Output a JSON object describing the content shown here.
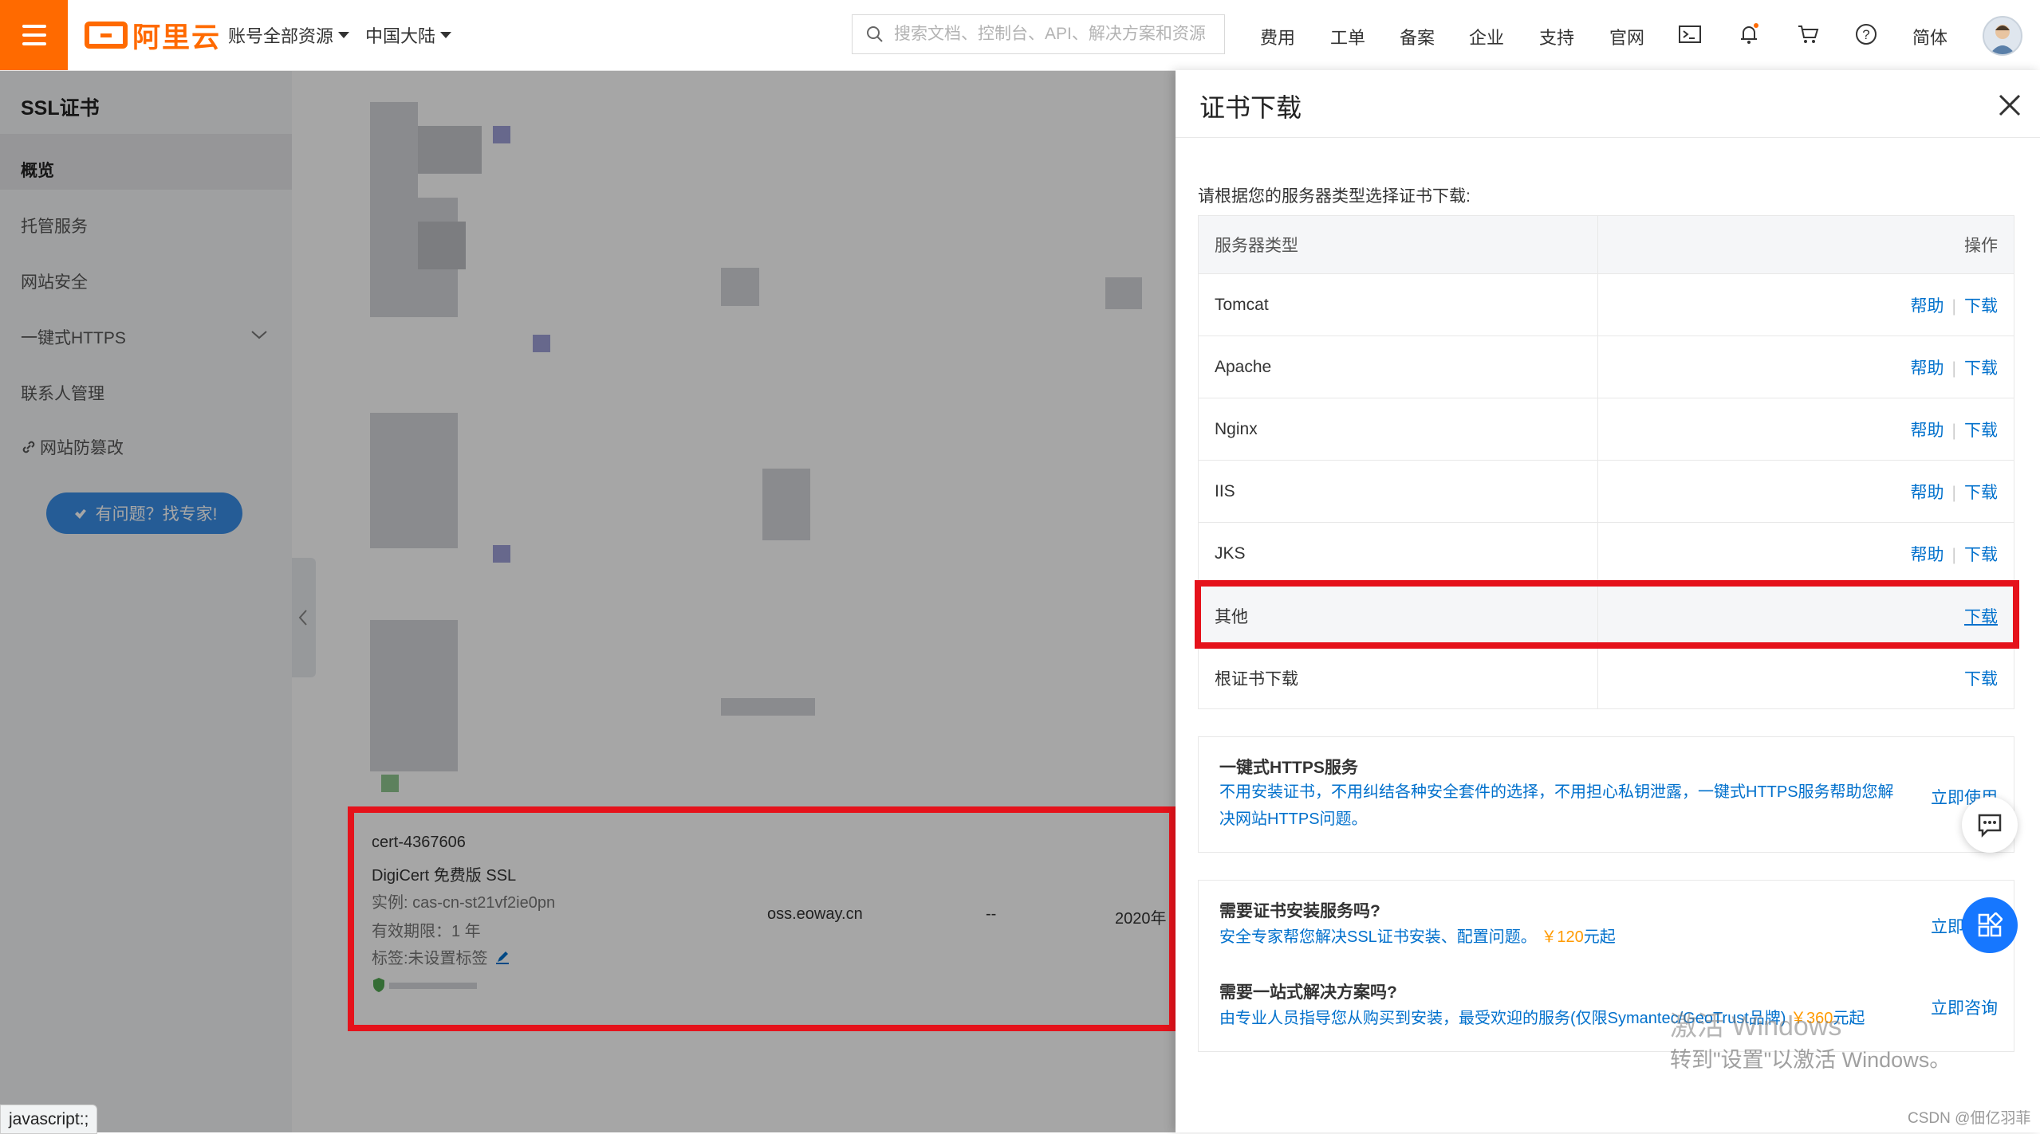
{
  "header": {
    "brand": "阿里云",
    "resources_dropdown": "账号全部资源",
    "region_dropdown": "中国大陆",
    "search_placeholder": "搜索文档、控制台、API、解决方案和资源",
    "nav": [
      "费用",
      "工单",
      "备案",
      "企业",
      "支持",
      "官网"
    ],
    "language": "简体"
  },
  "sidebar": {
    "title": "SSL证书",
    "items": [
      "概览",
      "托管服务",
      "网站安全",
      "一键式HTTPS",
      "联系人管理",
      "网站防篡改"
    ],
    "expert_button": "有问题？找专家!"
  },
  "cert_row": {
    "id": "cert-4367606",
    "product": "DigiCert 免费版 SSL",
    "instance": "实例: cas-cn-st21vf2ie0pn",
    "validity": "有效期限：1 年",
    "tags": "标签:未设置标签",
    "domain": "oss.eoway.cn",
    "dash": "--",
    "date": "2020年"
  },
  "drawer": {
    "title": "证书下载",
    "hint": "请根据您的服务器类型选择证书下载:",
    "columns": [
      "服务器类型",
      "操作"
    ],
    "help_label": "帮助",
    "download_label": "下载",
    "rows": [
      "Tomcat",
      "Apache",
      "Nginx",
      "IIS",
      "JKS",
      "其他",
      "根证书下载"
    ],
    "https_card": {
      "title": "一键式HTTPS服务",
      "text_line1": "不用安装证书，不用纠结各种安全套件的选择，不用担心私钥泄露，一键式HTTPS服务帮助您解",
      "text_line2": "决网站HTTPS问题。",
      "link": "立即使用"
    },
    "install_card": {
      "title": "需要证书安装服务吗?",
      "text": "安全专家帮您解决SSL证书安装、配置问题。",
      "price": "￥120",
      "price_suffix": "元起",
      "link": "立即"
    },
    "solution_card": {
      "title": "需要一站式解决方案吗?",
      "text": "由专业人员指导您从购买到安装，最受欢迎的服务(仅限Symantec/GeoTrust品牌)",
      "price": "￥360",
      "price_suffix": "元起",
      "link": "立即咨询"
    }
  },
  "windows_watermark": {
    "line1": "激活 Windows",
    "line2": "转到\"设置\"以激活 Windows。"
  },
  "csdn_mark": "CSDN @佃亿羽菲",
  "status_bar": "javascript:;",
  "colors": {
    "brand_orange": "#ff6a00",
    "link_blue": "#0070cc",
    "highlight_red": "#e5121b",
    "price_orange": "#ff9a00"
  }
}
